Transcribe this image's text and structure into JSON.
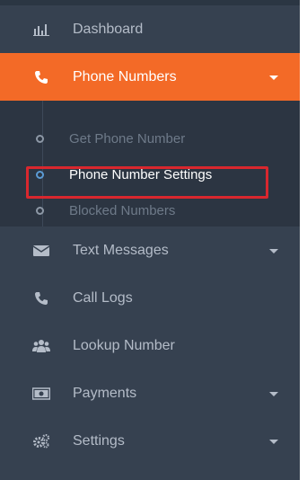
{
  "sidebar": {
    "items": [
      {
        "label": "Dashboard",
        "icon": "bar-chart-icon"
      },
      {
        "label": "Phone Numbers",
        "icon": "phone-icon"
      },
      {
        "label": "Text Messages",
        "icon": "envelope-icon"
      },
      {
        "label": "Call Logs",
        "icon": "phone-icon"
      },
      {
        "label": "Lookup Number",
        "icon": "users-icon"
      },
      {
        "label": "Payments",
        "icon": "money-icon"
      },
      {
        "label": "Settings",
        "icon": "cogs-icon"
      }
    ],
    "submenu": [
      {
        "label": "Get Phone Number"
      },
      {
        "label": "Phone Number Settings"
      },
      {
        "label": "Blocked Numbers"
      }
    ]
  },
  "colors": {
    "sidebar_bg": "#364150",
    "submenu_bg": "#2c3542",
    "active_bg": "#f36a27",
    "highlight": "#d9272e",
    "text": "#b4bcc8"
  }
}
